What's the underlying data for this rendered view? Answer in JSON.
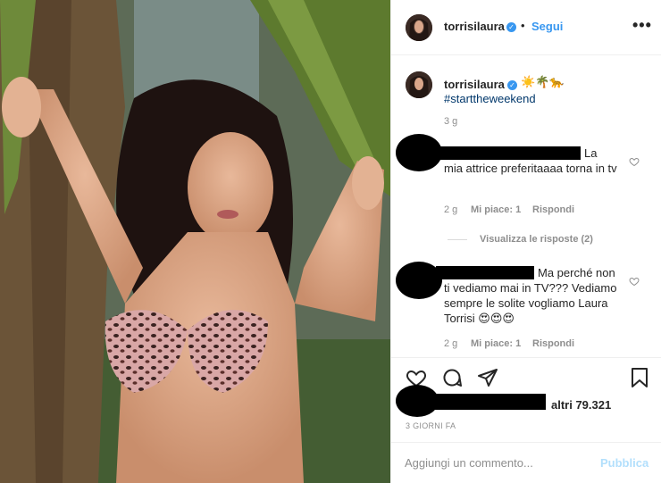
{
  "colors": {
    "link_blue": "#3897f0",
    "hashtag_blue": "#00376b",
    "muted_gray": "#8e8e8e",
    "publish_disabled": "#b2dffc",
    "redaction": "#000000"
  },
  "post": {
    "image_alt": "photo-of-woman-in-leopard-bikini-under-palm-fronds"
  },
  "header": {
    "username": "torrisilaura",
    "verified_icon": "verified-badge-icon",
    "separator": "•",
    "follow_label": "Segui",
    "more_icon": "more-options-icon",
    "more_label": "•••"
  },
  "caption": {
    "username": "torrisilaura",
    "emojis": "☀️🌴🐆",
    "hashtag": "#starttheweekend",
    "time": "3 g"
  },
  "comments": [
    {
      "text_line1": "La",
      "text_rest": "mia attrice preferitaaaa torna in tv",
      "time": "2 g",
      "likes": "Mi piace: 1",
      "reply_label": "Rispondi",
      "view_replies": "Visualizza le risposte (2)"
    },
    {
      "text_line1": "Ma perché non",
      "text_rest": "ti vediamo mai in TV??? Vediamo sempre le solite vogliamo Laura Torrisi 😍😍😍",
      "time": "2 g",
      "likes": "Mi piace: 1",
      "reply_label": "Rispondi"
    }
  ],
  "actions": {
    "like_icon": "heart-icon",
    "comment_icon": "comment-bubble-icon",
    "share_icon": "paper-plane-icon",
    "save_icon": "bookmark-icon",
    "likes_text": "altri 79.321",
    "date": "3 GIORNI FA"
  },
  "add_comment": {
    "placeholder": "Aggiungi un commento...",
    "publish_label": "Pubblica"
  }
}
